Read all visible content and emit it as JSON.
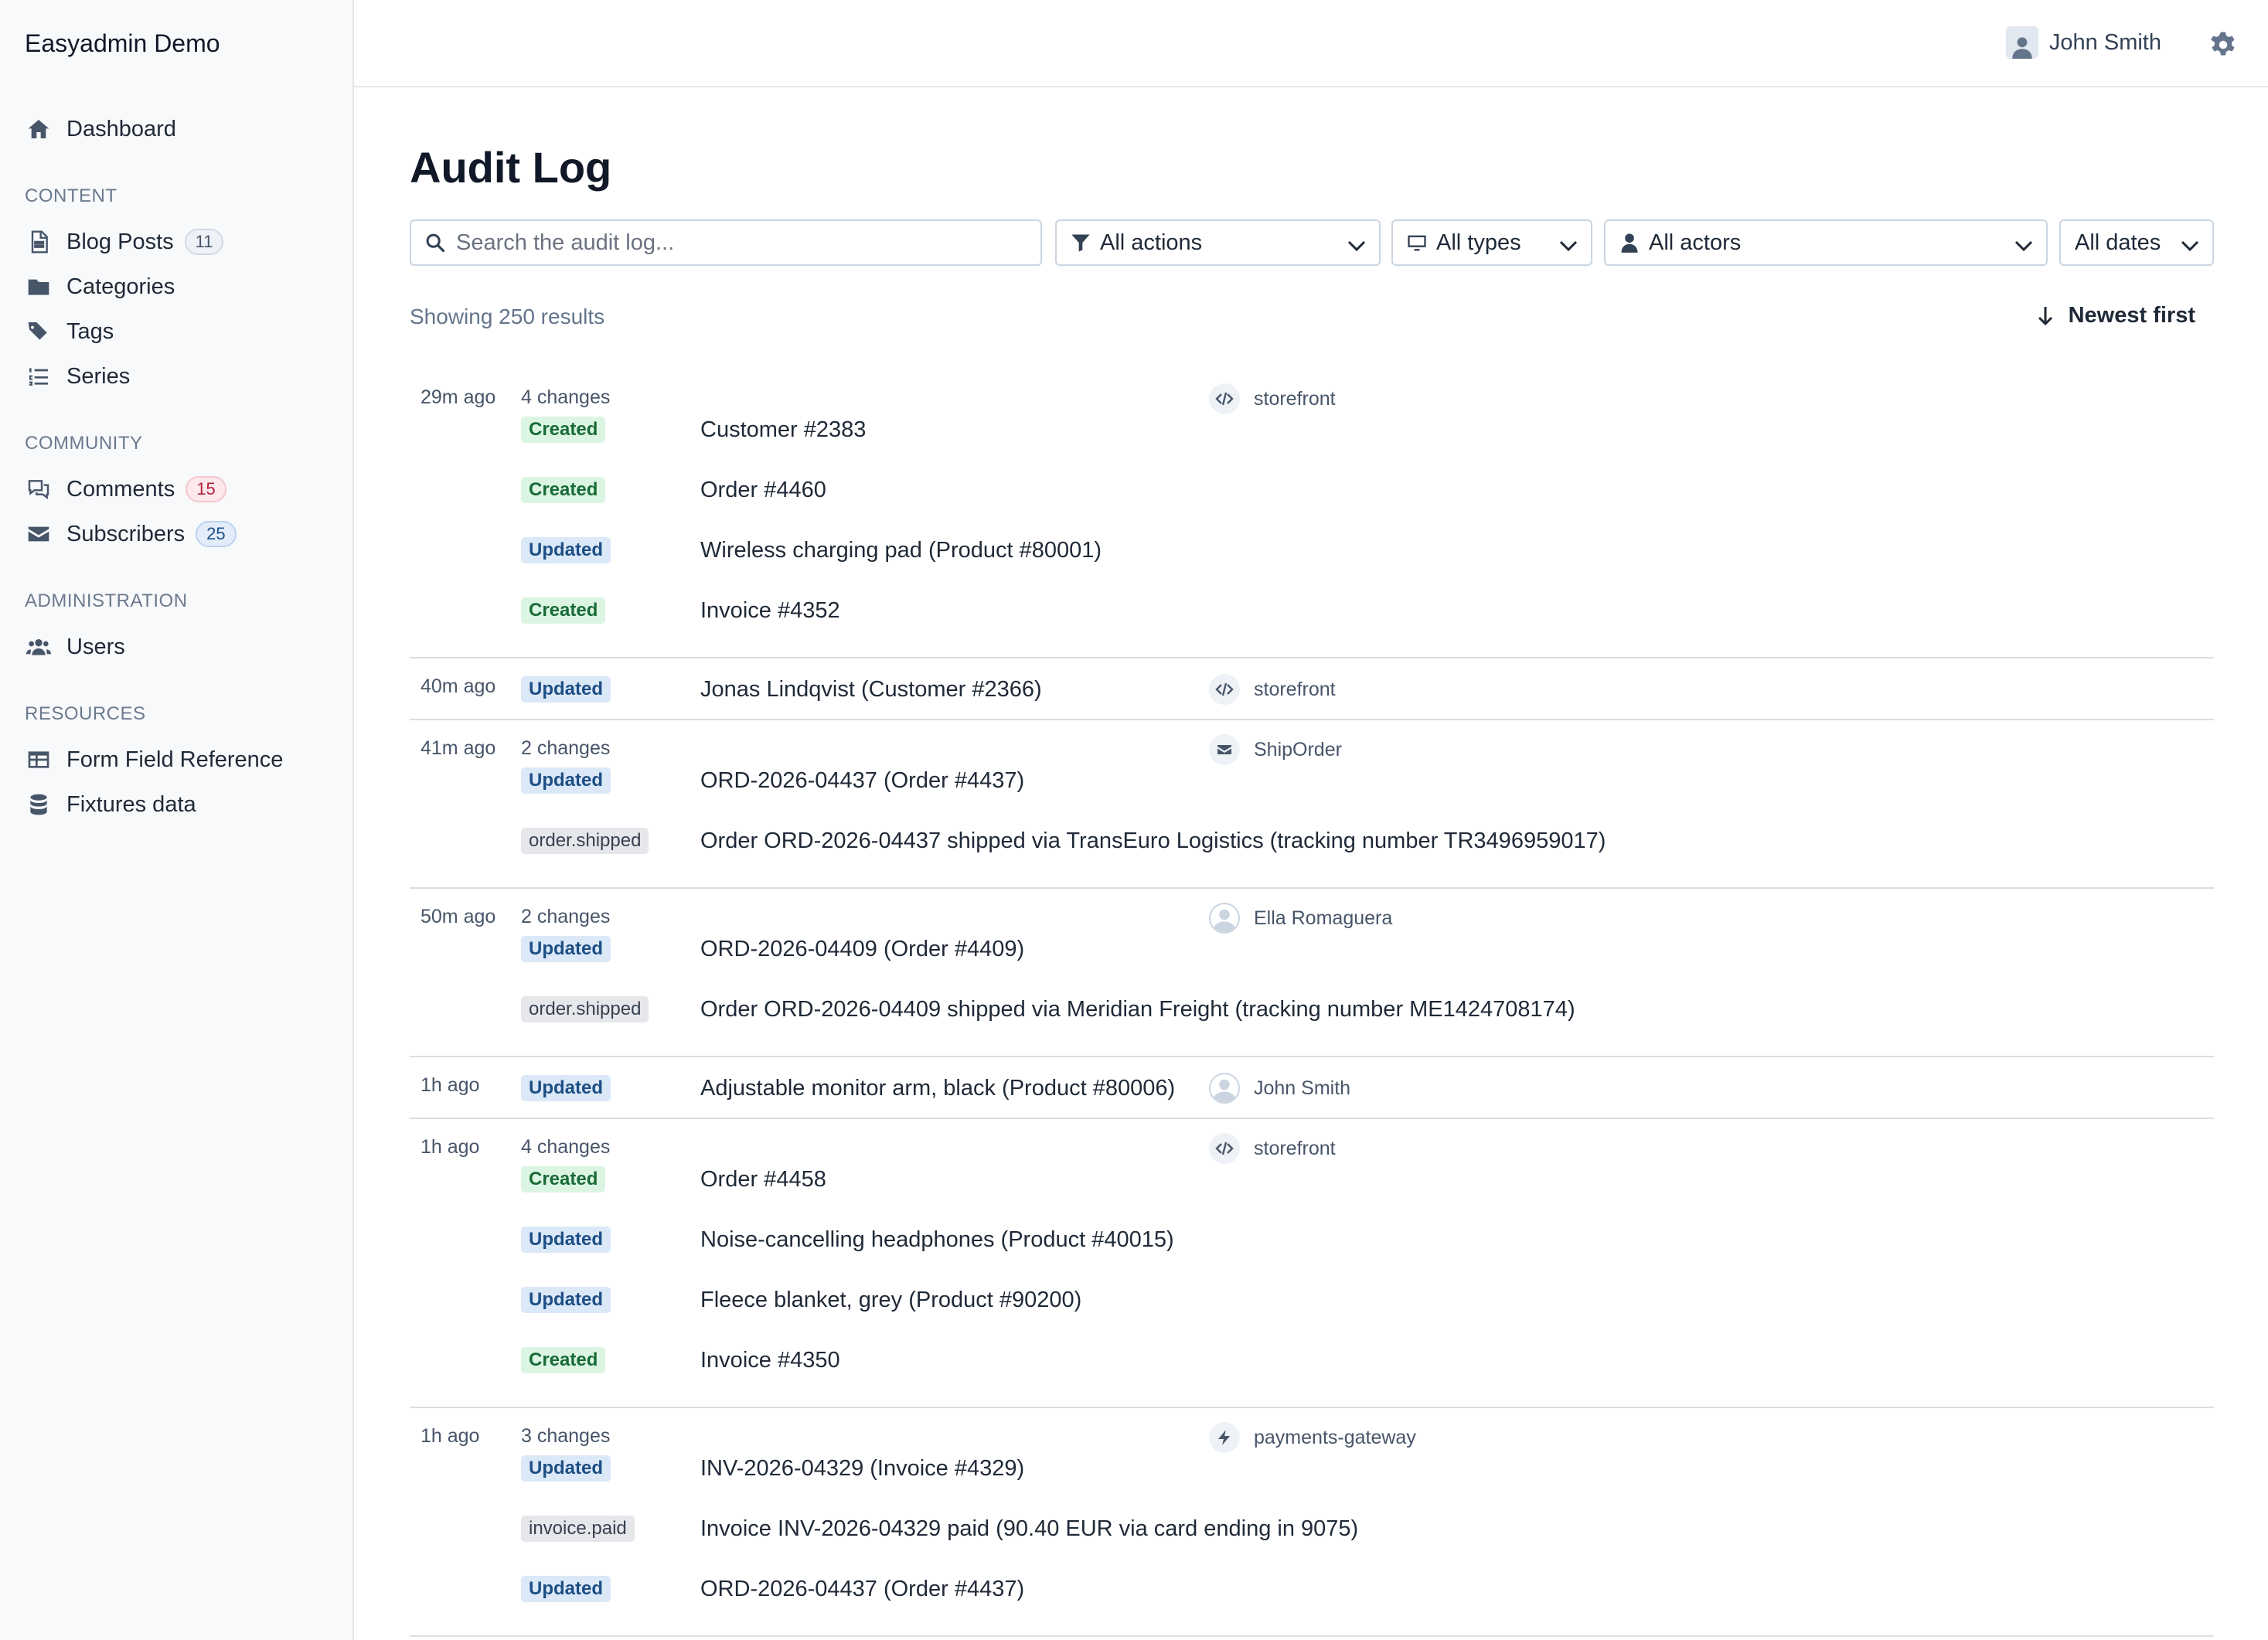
{
  "app": {
    "title": "Easyadmin Demo"
  },
  "sidebar": {
    "dashboard": "Dashboard",
    "sections": {
      "content": "CONTENT",
      "community": "COMMUNITY",
      "administration": "ADMINISTRATION",
      "resources": "RESOURCES"
    },
    "items": {
      "blog_posts": {
        "label": "Blog Posts",
        "count": "11"
      },
      "categories": {
        "label": "Categories"
      },
      "tags": {
        "label": "Tags"
      },
      "series": {
        "label": "Series"
      },
      "comments": {
        "label": "Comments",
        "count": "15"
      },
      "subscribers": {
        "label": "Subscribers",
        "count": "25"
      },
      "users": {
        "label": "Users"
      },
      "form_field_reference": {
        "label": "Form Field Reference"
      },
      "fixtures_data": {
        "label": "Fixtures data"
      }
    }
  },
  "header": {
    "user_name": "John Smith"
  },
  "page": {
    "title": "Audit Log",
    "search_placeholder": "Search the audit log...",
    "filters": {
      "actions": "All actions",
      "types": "All types",
      "actors": "All actors",
      "dates": "All dates"
    },
    "results": "Showing 250 results",
    "sort": "Newest first"
  },
  "entries": [
    {
      "time": "29m ago",
      "changes": "4 changes",
      "actor": "storefront",
      "actor_icon": "code-icon",
      "rows": [
        {
          "badge": "Created",
          "kind": "created",
          "text": "Customer #2383"
        },
        {
          "badge": "Created",
          "kind": "created",
          "text": "Order #4460"
        },
        {
          "badge": "Updated",
          "kind": "updated",
          "text": "Wireless charging pad (Product #80001)"
        },
        {
          "badge": "Created",
          "kind": "created",
          "text": "Invoice #4352"
        }
      ]
    },
    {
      "time": "40m ago",
      "changes": "",
      "actor": "storefront",
      "actor_icon": "code-icon",
      "rows": [
        {
          "badge": "Updated",
          "kind": "updated",
          "text": "Jonas Lindqvist (Customer #2366)"
        }
      ]
    },
    {
      "time": "41m ago",
      "changes": "2 changes",
      "actor": "ShipOrder",
      "actor_icon": "envelope-icon",
      "rows": [
        {
          "badge": "Updated",
          "kind": "updated",
          "text": "ORD-2026-04437 (Order #4437)"
        },
        {
          "badge": "order.shipped",
          "kind": "event",
          "text": "Order ORD-2026-04437 shipped via TransEuro Logistics (tracking number TR3496959017)"
        }
      ]
    },
    {
      "time": "50m ago",
      "changes": "2 changes",
      "actor": "Ella Romaguera",
      "actor_icon": "user-avatar-icon",
      "rows": [
        {
          "badge": "Updated",
          "kind": "updated",
          "text": "ORD-2026-04409 (Order #4409)"
        },
        {
          "badge": "order.shipped",
          "kind": "event",
          "text": "Order ORD-2026-04409 shipped via Meridian Freight (tracking number ME1424708174)"
        }
      ]
    },
    {
      "time": "1h ago",
      "changes": "",
      "actor": "John Smith",
      "actor_icon": "user-avatar-icon",
      "rows": [
        {
          "badge": "Updated",
          "kind": "updated",
          "text": "Adjustable monitor arm, black (Product #80006)"
        }
      ]
    },
    {
      "time": "1h ago",
      "changes": "4 changes",
      "actor": "storefront",
      "actor_icon": "code-icon",
      "rows": [
        {
          "badge": "Created",
          "kind": "created",
          "text": "Order #4458"
        },
        {
          "badge": "Updated",
          "kind": "updated",
          "text": "Noise-cancelling headphones (Product #40015)"
        },
        {
          "badge": "Updated",
          "kind": "updated",
          "text": "Fleece blanket, grey (Product #90200)"
        },
        {
          "badge": "Created",
          "kind": "created",
          "text": "Invoice #4350"
        }
      ]
    },
    {
      "time": "1h ago",
      "changes": "3 changes",
      "actor": "payments-gateway",
      "actor_icon": "bolt-icon",
      "rows": [
        {
          "badge": "Updated",
          "kind": "updated",
          "text": "INV-2026-04329 (Invoice #4329)"
        },
        {
          "badge": "invoice.paid",
          "kind": "event",
          "text": "Invoice INV-2026-04329 paid (90.40 EUR via card ending in 9075)"
        },
        {
          "badge": "Updated",
          "kind": "updated",
          "text": "ORD-2026-04437 (Order #4437)"
        }
      ]
    }
  ]
}
